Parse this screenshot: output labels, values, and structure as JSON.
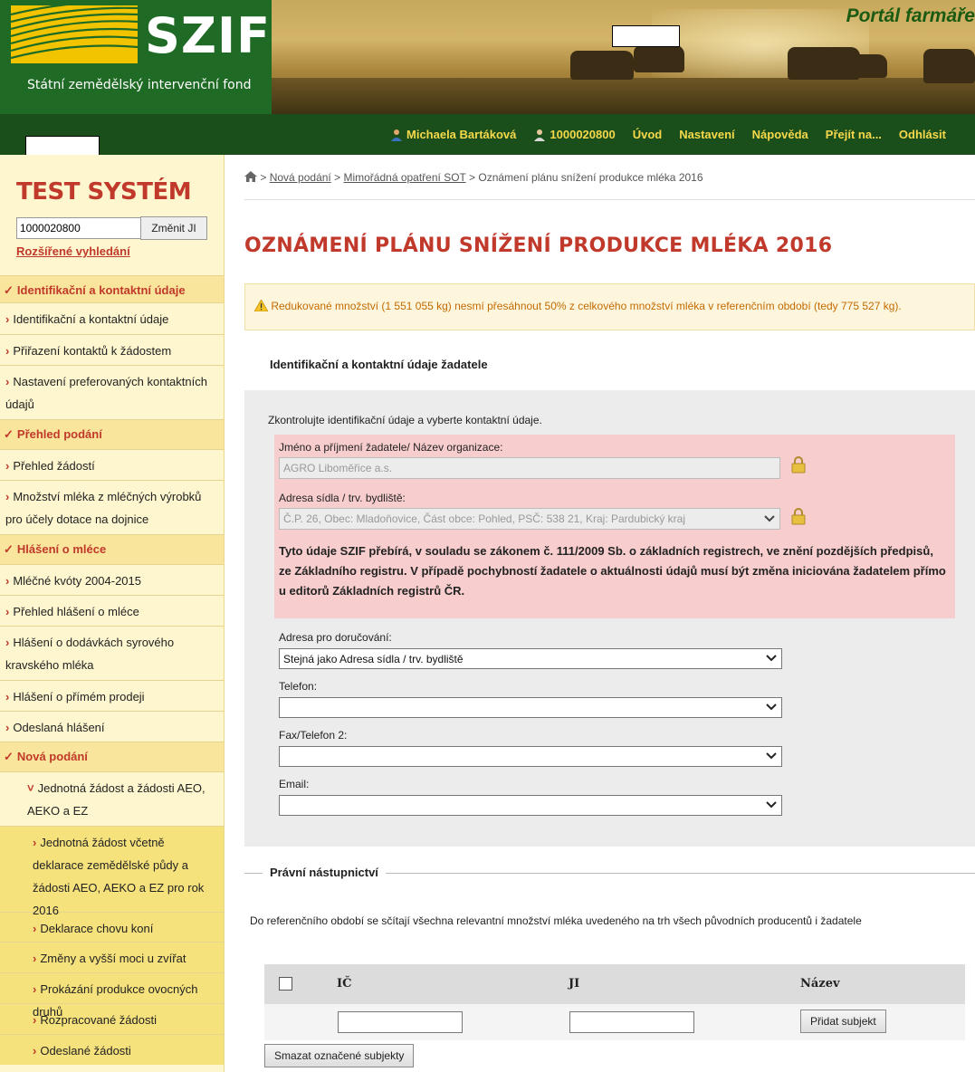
{
  "header": {
    "logo_text": "SZIF",
    "logo_subtitle": "Státní zemědělský intervenční fond",
    "portal_title": "Portál farmáře"
  },
  "topnav": {
    "user_name": "Michaela Bartáková",
    "user_id": "1000020800",
    "items": [
      "Úvod",
      "Nastavení",
      "Nápověda",
      "Přejít na...",
      "Odhlásit"
    ]
  },
  "sidebar": {
    "system_title": "TEST SYSTÉM",
    "ji_value": "1000020800",
    "ji_button": "Změnit JI",
    "advanced_search": "Rozšířené vyhledání",
    "menu": [
      {
        "label": "Identifikační a kontaktní údaje",
        "type": "head"
      },
      {
        "label": "Identifikační a kontaktní údaje",
        "type": "item"
      },
      {
        "label": "Přiřazení kontaktů k žádostem",
        "type": "item"
      },
      {
        "label": "Nastavení preferovaných kontaktních údajů",
        "type": "item"
      },
      {
        "label": "Přehled podání",
        "type": "head"
      },
      {
        "label": "Přehled žádostí",
        "type": "item"
      },
      {
        "label": "Množství mléka z mléčných výrobků pro účely dotace na dojnice",
        "type": "item"
      },
      {
        "label": "Hlášení o mléce",
        "type": "head"
      },
      {
        "label": "Mléčné kvóty 2004-2015",
        "type": "item"
      },
      {
        "label": "Přehled hlášení o mléce",
        "type": "item"
      },
      {
        "label": "Hlášení o dodávkách syrového kravského mléka",
        "type": "item"
      },
      {
        "label": "Hlášení o přímém prodeji",
        "type": "item"
      },
      {
        "label": "Odeslaná hlášení",
        "type": "item"
      },
      {
        "label": "Nová podání",
        "type": "head"
      },
      {
        "label": "Jednotná žádost a žádosti AEO, AEKO a EZ",
        "type": "open"
      },
      {
        "label": "Jednotná žádost včetně deklarace zemědělské půdy a žádosti AEO, AEKO a EZ pro rok 2016",
        "type": "sub"
      },
      {
        "label": "Deklarace chovu koní",
        "type": "sub"
      },
      {
        "label": "Změny a vyšší moci u zvířat",
        "type": "sub"
      },
      {
        "label": "Prokázání produkce ovocných druhů",
        "type": "sub"
      },
      {
        "label": "Rozpracované žádosti",
        "type": "sub"
      },
      {
        "label": "Odeslané žádosti",
        "type": "sub"
      }
    ]
  },
  "breadcrumb": {
    "sep": ">",
    "items": [
      "Nová podání",
      "Mimořádná opatření SOT"
    ],
    "current": "Oznámení plánu snížení produkce mléka 2016"
  },
  "page_title": "OZNÁMENÍ PLÁNU SNÍŽENÍ PRODUKCE MLÉKA 2016",
  "warning": "Redukované množství (1 551 055 kg) nesmí přesáhnout 50% z celkového množství mléka v referenčním období (tedy 775 527 kg).",
  "identification": {
    "legend": "Identifikační a kontaktní údaje žadatele",
    "instruction": "Zkontrolujte identifikační údaje a vyberte kontaktní údaje.",
    "name_label": "Jméno a příjmení žadatele/ Název organizace:",
    "name_value": "AGRO Liboměřice a.s.",
    "address_label": "Adresa sídla / trv. bydliště:",
    "address_value": "Č.P. 26, Obec: Mladoňovice, Část obce: Pohled, PSČ: 538 21, Kraj: Pardubický kraj",
    "info": "Tyto údaje SZIF přebírá, v souladu se zákonem č. 111/2009 Sb. o základních registrech, ve znění pozdějších předpisů, ze Základního registru. V případě pochybností žadatele o aktuálnosti údajů musí být změna iniciována žadatelem přímo u editorů Základních registrů ČR.",
    "delivery_label": "Adresa pro doručování:",
    "delivery_value": "Stejná jako Adresa sídla / trv. bydliště",
    "phone_label": "Telefon:",
    "phone_value": "",
    "fax_label": "Fax/Telefon 2:",
    "fax_value": "",
    "email_label": "Email:",
    "email_value": ""
  },
  "succession": {
    "legend": "Právní nástupnictví",
    "instruction": "Do referenčního období se sčítají všechna relevantní množství mléka uvedeného na trh všech původních producentů i žadatele",
    "columns": [
      "IČ",
      "JI",
      "Název"
    ],
    "add_button": "Přidat subjekt",
    "delete_button": "Smazat označené subjekty"
  },
  "colors": {
    "brand_red": "#c0392b",
    "nav_green": "#1a4f1c",
    "nav_text": "#f7d84a",
    "sidebar_bg": "#fdf6ce",
    "warning_text": "#c46a00",
    "pink_box": "#f7cdcd"
  }
}
